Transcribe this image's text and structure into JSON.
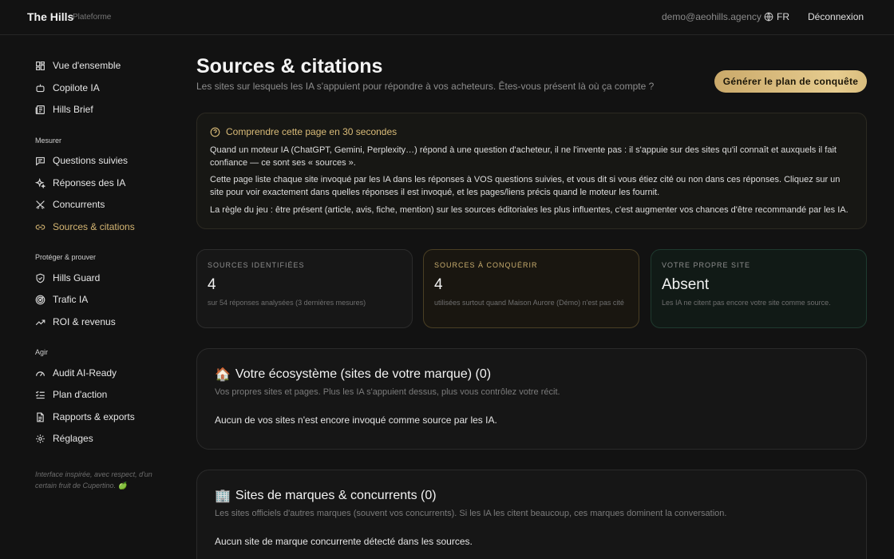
{
  "header": {
    "brand": "The Hills",
    "brand_sub": "Plateforme",
    "email": "demo@aeohills.agency",
    "lang": "FR",
    "logout": "Déconnexion"
  },
  "sidebar": {
    "top_items": [
      {
        "label": "Vue d'ensemble",
        "icon": "dashboard-icon"
      },
      {
        "label": "Copilote IA",
        "icon": "robot-icon"
      },
      {
        "label": "Hills Brief",
        "icon": "newspaper-icon"
      }
    ],
    "groups": [
      {
        "title": "Mesurer",
        "items": [
          {
            "label": "Questions suivies",
            "icon": "chat-icon"
          },
          {
            "label": "Réponses des IA",
            "icon": "sparkle-icon"
          },
          {
            "label": "Concurrents",
            "icon": "swords-icon"
          },
          {
            "label": "Sources & citations",
            "icon": "link-icon"
          }
        ]
      },
      {
        "title": "Protéger & prouver",
        "items": [
          {
            "label": "Hills Guard",
            "icon": "shield-icon"
          },
          {
            "label": "Trafic IA",
            "icon": "radar-icon"
          },
          {
            "label": "ROI & revenus",
            "icon": "trend-up-icon"
          }
        ]
      },
      {
        "title": "Agir",
        "items": [
          {
            "label": "Audit AI-Ready",
            "icon": "gauge-icon"
          },
          {
            "label": "Plan d'action",
            "icon": "checklist-icon"
          },
          {
            "label": "Rapports & exports",
            "icon": "document-icon"
          },
          {
            "label": "Réglages",
            "icon": "gear-icon"
          }
        ]
      }
    ],
    "active": "Sources & citations",
    "footnote": "Interface inspirée, avec respect, d'un certain fruit de Cupertino. 🍏"
  },
  "main": {
    "title": "Sources & citations",
    "subtitle": "Les sites sur lesquels les IA s'appuient pour répondre à vos acheteurs. Êtes-vous présent là où ça compte ?",
    "cta": "Générer le plan de conquête",
    "info": {
      "heading": "Comprendre cette page en 30 secondes",
      "p1": "Quand un moteur IA (ChatGPT, Gemini, Perplexity…) répond à une question d'acheteur, il ne l'invente pas : il s'appuie sur des sites qu'il connaît et auxquels il fait confiance — ce sont ses « sources ».",
      "p2": "Cette page liste chaque site invoqué par les IA dans les réponses à VOS questions suivies, et vous dit si vous étiez cité ou non dans ces réponses. Cliquez sur un site pour voir exactement dans quelles réponses il est invoqué, et les pages/liens précis quand le moteur les fournit.",
      "p3": "La règle du jeu : être présent (article, avis, fiche, mention) sur les sources éditoriales les plus influentes, c'est augmenter vos chances d'être recommandé par les IA."
    },
    "stats": [
      {
        "label": "SOURCES IDENTIFIÉES",
        "value": "4",
        "desc": "sur 54 réponses analysées (3 dernières mesures)"
      },
      {
        "label": "SOURCES À CONQUÉRIR",
        "value": "4",
        "desc": "utilisées surtout quand Maison Aurore (Démo) n'est pas cité"
      },
      {
        "label": "VOTRE PROPRE SITE",
        "value": "Absent",
        "desc": "Les IA ne citent pas encore votre site comme source."
      }
    ],
    "sections": [
      {
        "emoji": "🏠",
        "title": "Votre écosystème (sites de votre marque) (0)",
        "subtitle": "Vos propres sites et pages. Plus les IA s'appuient dessus, plus vous contrôlez votre récit.",
        "body": "Aucun de vos sites n'est encore invoqué comme source par les IA."
      },
      {
        "emoji": "🏢",
        "title": "Sites de marques & concurrents (0)",
        "subtitle": "Les sites officiels d'autres marques (souvent vos concurrents). Si les IA les citent beaucoup, ces marques dominent la conversation.",
        "body": "Aucun site de marque concurrente détecté dans les sources."
      }
    ]
  },
  "colors": {
    "accent": "#d4b572",
    "background": "#121212"
  }
}
